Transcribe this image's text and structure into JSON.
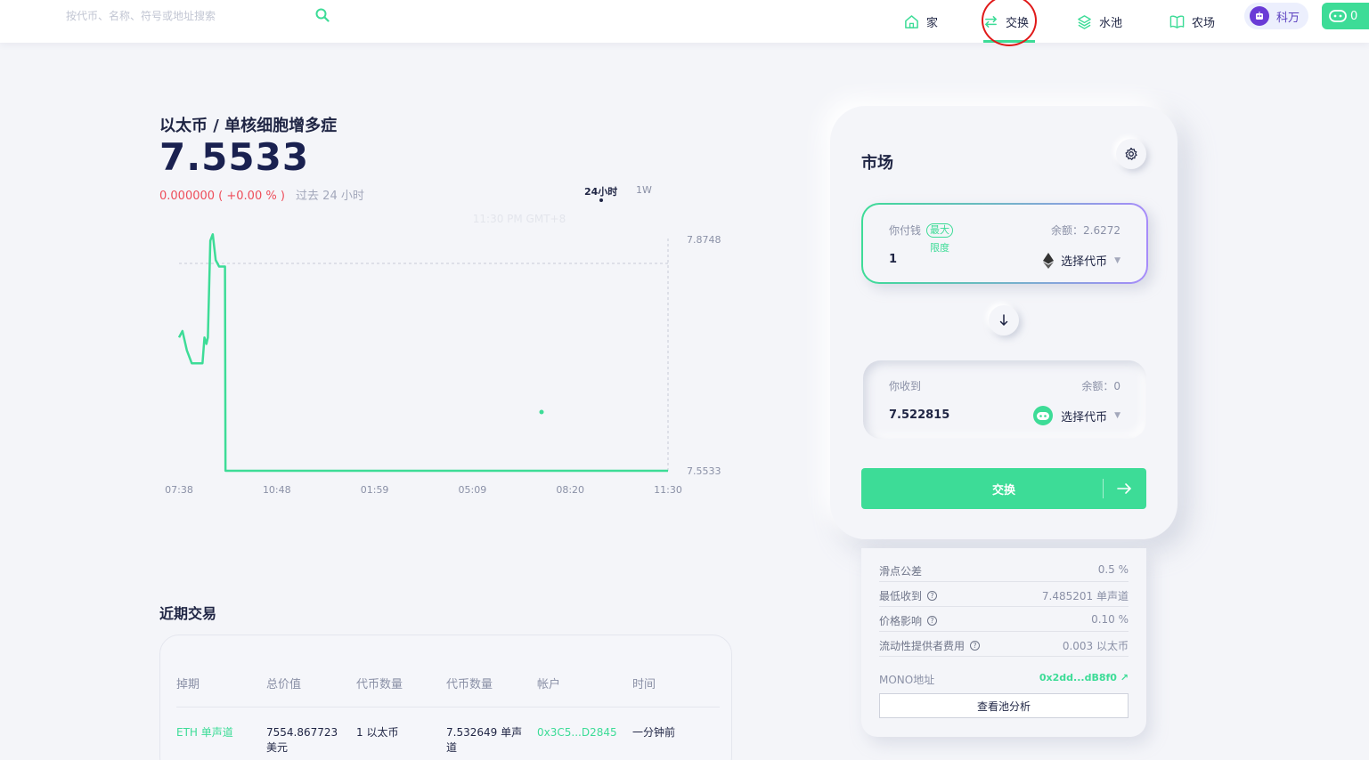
{
  "header": {
    "search_placeholder": "按代币、名称、符号或地址搜索",
    "nav": [
      {
        "label": "家",
        "icon": "home-icon",
        "active": false
      },
      {
        "label": "交换",
        "icon": "swap-arrows-icon",
        "active": true
      },
      {
        "label": "水池",
        "icon": "layers-icon",
        "active": false
      },
      {
        "label": "农场",
        "icon": "book-icon",
        "active": false
      }
    ],
    "wallet_label": "科万",
    "green_chip_label": "0"
  },
  "pair": {
    "title": "以太币 / 单核细胞增多症",
    "price": "7.5533",
    "change_value": "0.000000",
    "change_pct": "( +0.00 % )",
    "change_period": "过去 24 小时",
    "timeframes": [
      "24小时",
      "1W"
    ]
  },
  "chart_data": {
    "type": "line",
    "x": [
      "07:38",
      "10:48",
      "01:59",
      "05:09",
      "08:20",
      "11:30"
    ],
    "y_ticks": [
      "7.8748",
      "7.5533"
    ],
    "ylim": [
      7.5533,
      7.8748
    ],
    "reference_line": 7.8748,
    "hover_label": "11:30 PM GMT+8",
    "series": [
      {
        "values": [
          7.76,
          7.77,
          7.74,
          7.72,
          7.72,
          7.72,
          7.72,
          7.76,
          7.75,
          7.76,
          7.91,
          7.92,
          7.88,
          7.87,
          7.87,
          7.5533,
          7.5533,
          7.5533,
          7.5533,
          7.5533,
          7.5533,
          7.5533
        ],
        "t": [
          0,
          0.7,
          1.6,
          2.6,
          3.5,
          4.4,
          4.8,
          5.2,
          5.6,
          5.9,
          6.4,
          6.9,
          7.5,
          8.2,
          9.4,
          9.5,
          20,
          40,
          60,
          80,
          95,
          100
        ],
        "color": "#3ddc97"
      }
    ]
  },
  "recent_trades": {
    "title": "近期交易",
    "columns": [
      "掉期",
      "总价值",
      "代币数量",
      "代币数量",
      "帐户",
      "时间"
    ],
    "rows": [
      [
        "ETH 单声道",
        "7554.867723 美元",
        "1 以太币",
        "7.532649 单声道",
        "0x3C5...D2845",
        "一分钟前"
      ]
    ]
  },
  "swap": {
    "title": "市场",
    "pay_label": "你付钱",
    "max_label": "最大",
    "limit_label": "限度",
    "pay_balance": "余额：2.6272",
    "pay_amount": "1",
    "pay_token": "选择代币",
    "receive_label": "你收到",
    "receive_balance": "余额：0",
    "receive_amount": "7.522815",
    "receive_token": "选择代币",
    "swap_button": "交换"
  },
  "details": {
    "rows": [
      {
        "label": "滑点公差",
        "value": "0.5 %",
        "help": false
      },
      {
        "label": "最低收到",
        "value": "7.485201 单声道",
        "help": true
      },
      {
        "label": "价格影响",
        "value": "0.10 %",
        "help": true
      },
      {
        "label": "流动性提供者费用",
        "value": "0.003 以太币",
        "help": true
      }
    ],
    "mono_label": "MONO地址",
    "mono_value": "0x2dd...dB8f0 ↗",
    "view_pool_button": "查看池分析"
  },
  "colors": {
    "accent": "#3ddc97",
    "negative": "#ee4d5a",
    "annotation": "#e01919"
  }
}
